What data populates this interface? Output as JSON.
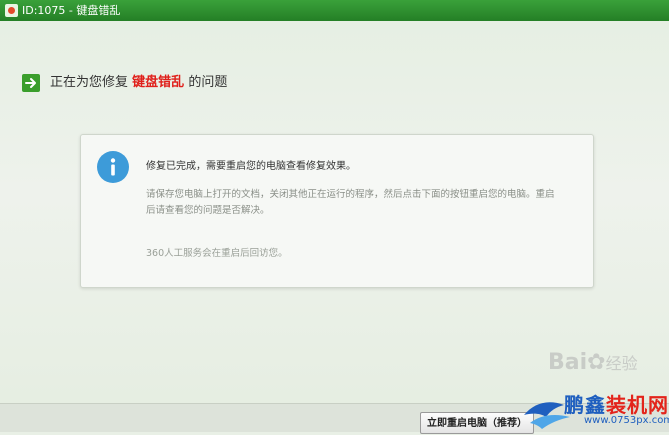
{
  "window": {
    "title": "ID:1075 - 键盘错乱"
  },
  "header": {
    "prefix": "正在为您修复",
    "highlight": "键盘错乱",
    "suffix": "的问题",
    "highlight_color": "#e0201b"
  },
  "card": {
    "main_message": "修复已完成，需要重启您的电脑查看修复效果。",
    "sub_message": "请保存您电脑上打开的文档，关闭其他正在运行的程序，然后点击下面的按钮重启您的电脑。重启后请查看您的问题是否解决。",
    "service_message": "360人工服务会在重启后回访您。"
  },
  "footer": {
    "restart_button": "立即重启电脑（推荐）"
  },
  "watermarks": {
    "baidu": "Bai",
    "baidu_icon": "paw-icon",
    "baidu_suffix": "经验",
    "site_brand_blue": "鹏鑫",
    "site_brand_red": "装机网",
    "site_url": "www.0753px.com"
  },
  "colors": {
    "titlebar": "#2a8a2e",
    "accent_green": "#3a9e2c",
    "info_blue": "#3d9bd9"
  }
}
